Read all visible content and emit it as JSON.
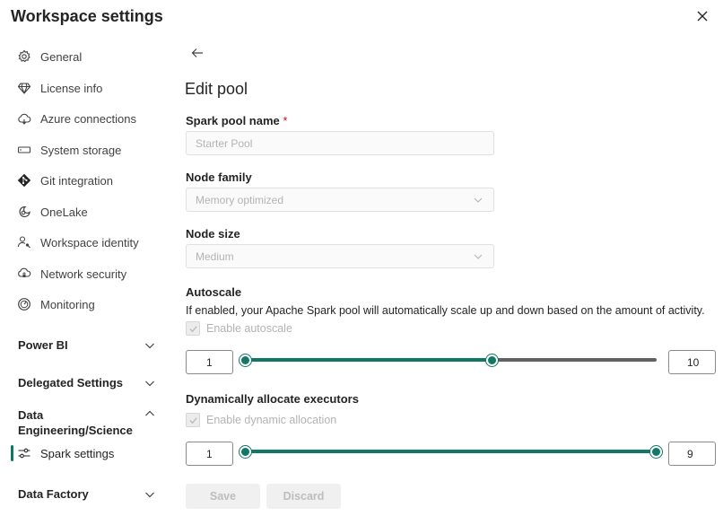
{
  "window": {
    "title": "Workspace settings"
  },
  "sidebar": {
    "items": [
      {
        "label": "General",
        "icon": "gear-icon"
      },
      {
        "label": "License info",
        "icon": "diamond-icon"
      },
      {
        "label": "Azure connections",
        "icon": "cloud-icon"
      },
      {
        "label": "System storage",
        "icon": "storage-icon"
      },
      {
        "label": "Git integration",
        "icon": "git-icon"
      },
      {
        "label": "OneLake",
        "icon": "onelake-icon"
      },
      {
        "label": "Workspace identity",
        "icon": "identity-icon"
      },
      {
        "label": "Network security",
        "icon": "network-icon"
      },
      {
        "label": "Monitoring",
        "icon": "monitoring-icon"
      }
    ],
    "sections": {
      "power_bi": "Power BI",
      "delegated": "Delegated Settings",
      "data_engineering_1": "Data",
      "data_engineering_2": "Engineering/Science",
      "spark_settings": "Spark settings",
      "data_factory": "Data Factory"
    }
  },
  "main": {
    "heading": "Edit pool",
    "pool_name": {
      "label": "Spark pool name",
      "required": "*",
      "placeholder": "Starter Pool"
    },
    "node_family": {
      "label": "Node family",
      "value": "Memory optimized"
    },
    "node_size": {
      "label": "Node size",
      "value": "Medium"
    },
    "autoscale": {
      "label": "Autoscale",
      "description": "If enabled, your Apache Spark pool will automatically scale up and down based on the amount of activity.",
      "checkbox_label": "Enable autoscale",
      "checked": true,
      "min": "1",
      "max": "10"
    },
    "dynamic": {
      "label": "Dynamically allocate executors",
      "checkbox_label": "Enable dynamic allocation",
      "checked": true,
      "min": "1",
      "max": "9"
    },
    "buttons": {
      "save": "Save",
      "discard": "Discard"
    }
  },
  "colors": {
    "accent": "#117865",
    "track_gray": "#616161",
    "required": "#c50f1f"
  }
}
